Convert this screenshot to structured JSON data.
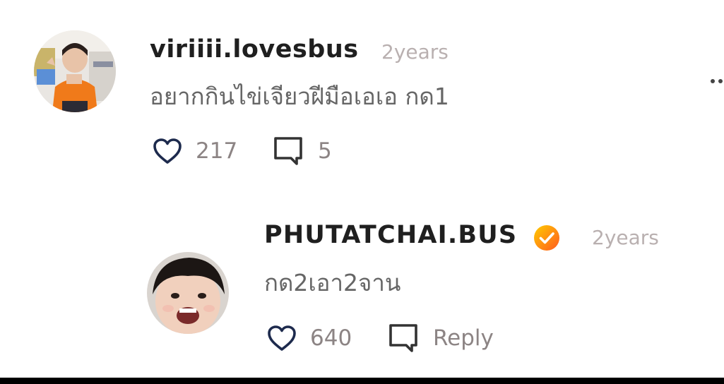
{
  "comments": [
    {
      "username": "viriiii.lovesbus",
      "time": "2years",
      "text": "อยากกินไข่เจียวฝีมือเอเอ กด1",
      "likes": "217",
      "replies": "5",
      "avatar": "user-photo-child-orange-shirt"
    }
  ],
  "reply": {
    "username": "PHUTATCHAI.BUS",
    "verified": true,
    "time": "2years",
    "text": "กด2เอา2จาน",
    "likes": "640",
    "reply_label": "Reply",
    "avatar": "user-photo-laughing-child"
  },
  "icons": {
    "like": "heart-icon",
    "comment": "comment-bubble-icon",
    "more": "more-options-icon",
    "verified": "verified-badge-icon"
  },
  "colors": {
    "heart": "#1d2a4d",
    "verified_gradient_start": "#ffcc00",
    "verified_gradient_end": "#ff5a1f",
    "muted_text": "#8c8484"
  }
}
